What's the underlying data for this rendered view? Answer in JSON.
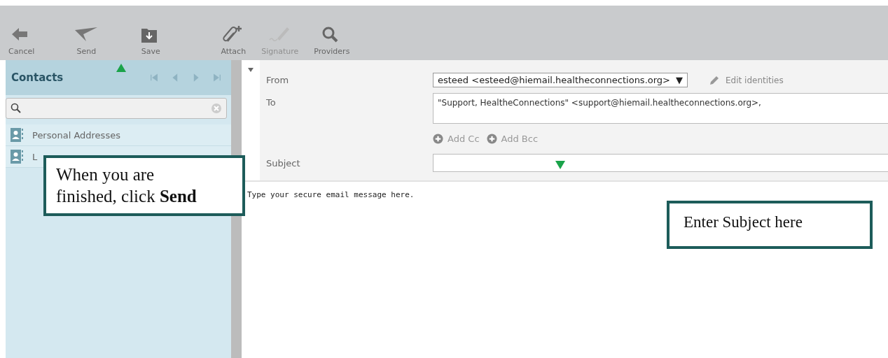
{
  "toolbar": [
    {
      "label": "Cancel",
      "kind": "back",
      "disabled": false
    },
    {
      "label": "Send",
      "kind": "send",
      "disabled": false
    },
    {
      "label": "Save",
      "kind": "save",
      "disabled": false
    },
    {
      "label": "Attach",
      "kind": "attach",
      "disabled": false
    },
    {
      "label": "Signature",
      "kind": "signature",
      "disabled": true
    },
    {
      "label": "Providers",
      "kind": "search",
      "disabled": false
    }
  ],
  "contacts": {
    "title": "Contacts",
    "items": [
      {
        "label": "Personal Addresses"
      },
      {
        "label": "L"
      }
    ]
  },
  "compose": {
    "from": {
      "label": "From",
      "value": "esteed <esteed@hiemail.healtheconnections.org>",
      "caret": "▼",
      "edit": "Edit identities"
    },
    "to": {
      "label": "To",
      "value": "\"Support, HealtheConnections\" <support@hiemail.healtheconnections.org>,"
    },
    "add": [
      {
        "label": "Add Cc"
      },
      {
        "label": "Add Bcc"
      }
    ],
    "subject": {
      "label": "Subject"
    },
    "body": "Type your secure email message here."
  },
  "callouts": [
    {
      "text": "When you are finished, click **Send**",
      "kind": "send"
    },
    {
      "text": "Enter Subject here",
      "kind": "subject"
    }
  ]
}
